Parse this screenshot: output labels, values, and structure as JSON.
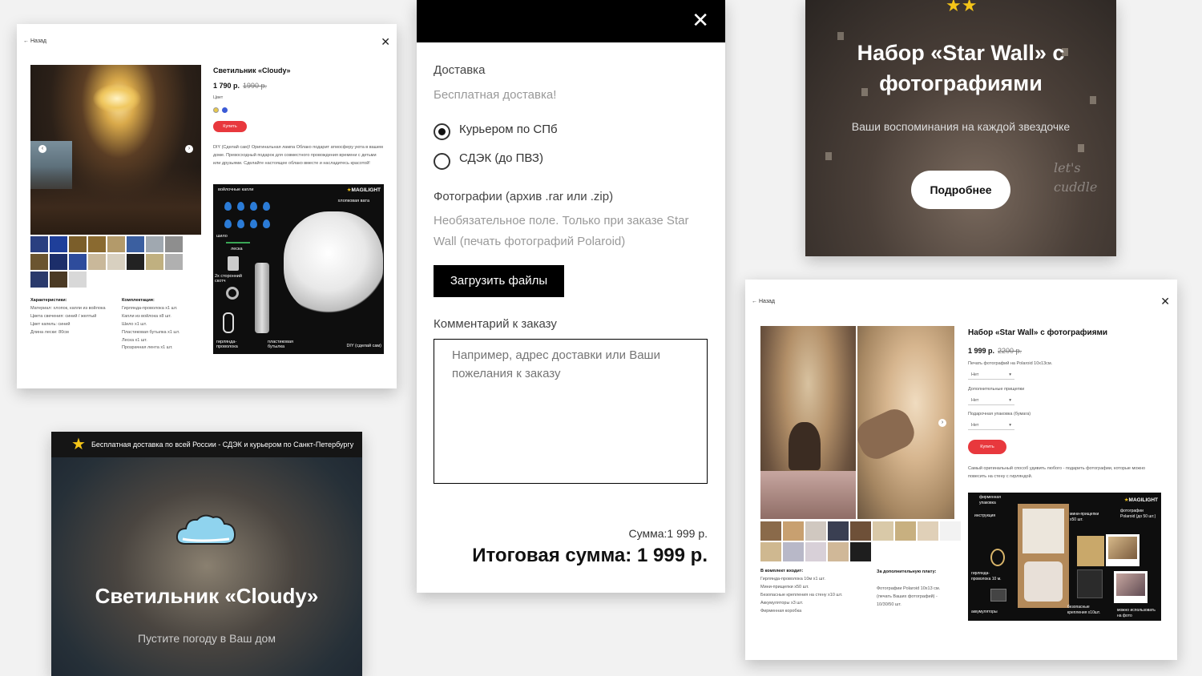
{
  "cloudy_product": {
    "back": "← Назад",
    "close": "✕",
    "title": "Светильник «Cloudy»",
    "price_current": "1 790 р.",
    "price_old": "1990 р.",
    "color_label": "Цвет",
    "swatch_colors": [
      "#e8c84a",
      "#3b5bd6"
    ],
    "buy": "Купить",
    "description": "DIY (Сделай сам)! Оригинальная лампа Облако подарит атмосферу уюта в вашем доме. Превосходный подарок для совместного провождения времени с детьми или друзьями. Сделайте настоящее облако вместе и насладитесь красотой!",
    "kit_brand": "MAGILIGHT",
    "kit_labels": {
      "drops": "войлочные капли",
      "cotton": "хлопковая вата",
      "awl": "шило",
      "line": "леска",
      "tape": "2х сторонний скотч",
      "garland": "гирлянда-проволока",
      "bottle": "пластиковая бутылка",
      "diy": "DIY (сделай сам)"
    },
    "specs_title": "Характеристики:",
    "specs": [
      "Материал: хлопок, капли из войлока",
      "Цвета свечения: синий / желтый",
      "Цвет капель: синий",
      "Длина лески: 80см"
    ],
    "kit_title": "Комплектация:",
    "kit_items": [
      "Гирлянда-проволока x1 шт.",
      "Капли из войлока x8 шт.",
      "Шило x1 шт.",
      "Пластиковая бутылка x1 шт.",
      "Леска x1 шт.",
      "Прозрачная лента x1 шт."
    ]
  },
  "delivery_form": {
    "close": "✕",
    "delivery_label": "Доставка",
    "delivery_note": "Бесплатная доставка!",
    "options": [
      "Курьером по СПб",
      "СДЭК (до ПВЗ)"
    ],
    "photos_label": "Фотографии (архив .rar или .zip)",
    "photos_note": "Необязательное поле. Только при заказе Star Wall (печать фотографий Polaroid)",
    "upload": "Загрузить файлы",
    "comment_label": "Комментарий к заказу",
    "comment_placeholder": "Например, адрес доставки или Ваши пожелания к заказу",
    "sum": "Сумма:1 999 р.",
    "total": "Итоговая сумма: 1 999 р."
  },
  "starwall_banner": {
    "title": "Набор «Star Wall» с фотографиями",
    "subtitle": "Ваши воспоминания на каждой звездочке",
    "button": "Подробнее",
    "handwriting": "let's cuddle"
  },
  "cloudy_banner": {
    "strip": "Бесплатная доставка по всей России - СДЭК и курьером по Санкт-Петербургу",
    "title": "Светильник «Cloudy»",
    "subtitle": "Пустите погоду в Ваш дом"
  },
  "starwall_product": {
    "back": "← Назад",
    "close": "✕",
    "title": "Набор «Star Wall» с фотографиями",
    "price_current": "1 999 р.",
    "price_old": "2200 р.",
    "option1_label": "Печать фотографий на Polaroid 10x13см.",
    "option2_label": "Дополнительные прищепки",
    "option3_label": "Подарочная упаковка (бумага)",
    "option_value": "Нет",
    "buy": "Купить",
    "description": "Самый оригинальный способ удивить любого - подарить фотографии, которые можно повесить на стену с гирляндой.",
    "kit_brand": "MAGILIGHT",
    "kit_labels": {
      "box": "фирменная упаковка",
      "manual": "инструкция",
      "pegs": "мини-прищепки x50 шт.",
      "photos": "фотографии Polaroid (до 50 шт.)",
      "garland": "гирлянда-проволока 10 м.",
      "mounts": "безопасные крепления x10шт.",
      "batteries": "аккумуляторы",
      "note": "можно использовать на фото"
    },
    "includes_title": "В комплект входит:",
    "includes": [
      "Гирлянда-проволока 10м x1 шт.",
      "Мини-прищепки x50 шт.",
      "Безопасные крепления на стену x10 шт.",
      "Аккумуляторы x3 шт.",
      "Фирменная коробка"
    ],
    "extra_title": "За дополнительную плату:",
    "extra": [
      "Фотографии Polaroid 10x13 см.",
      "(печать Ваших фотографий) -",
      "10/30/50 шт."
    ]
  }
}
